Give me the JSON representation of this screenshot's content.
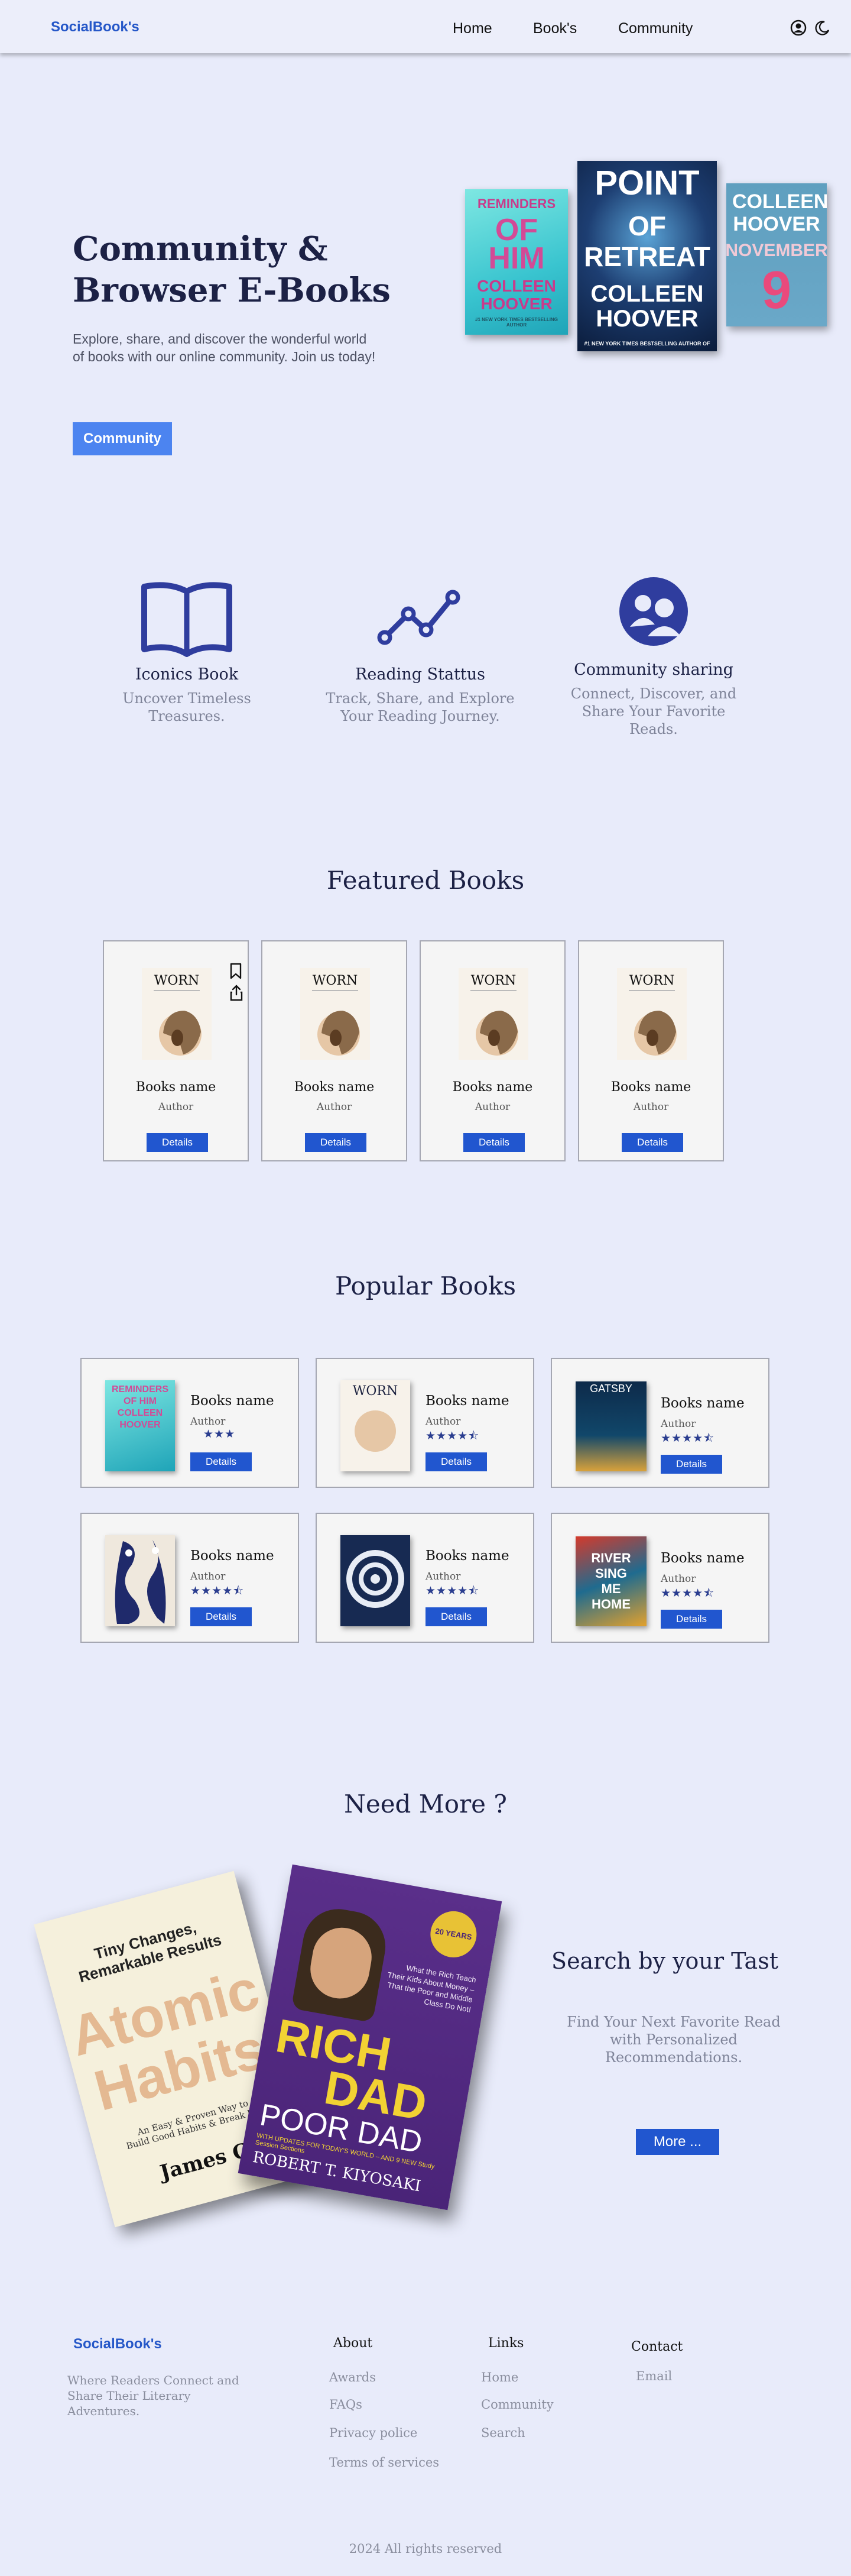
{
  "nav": {
    "logo": "SocialBook's",
    "links": [
      "Home",
      "Book's",
      "Community"
    ],
    "icons": [
      "user-circle-icon",
      "moon-icon"
    ]
  },
  "hero": {
    "title": "Community & Browser E-Books",
    "description": "Explore, share, and discover the wonderful world of books with our online community. Join us today!",
    "button": "Community",
    "covers": [
      {
        "top": "REMINDERS",
        "middle": "OF HIM",
        "author": "COLLEEN HOOVER",
        "bottom": "#1 NEW YORK TIMES BESTSELLING AUTHOR"
      },
      {
        "top": "POINT",
        "middle": "OF RETREAT",
        "author": "COLLEEN HOOVER",
        "bottom": "#1 NEW YORK TIMES BESTSELLING AUTHOR OF"
      },
      {
        "top": "COLLEEN HOOVER",
        "middle": "NOVEMBER",
        "author": "9",
        "bottom": ""
      }
    ]
  },
  "features": [
    {
      "icon": "open-book-icon",
      "title": "Iconics Book",
      "desc": "Uncover Timeless Treasures."
    },
    {
      "icon": "line-chart-icon",
      "title": "Reading Stattus",
      "desc": "Track, Share, and Explore Your Reading Journey."
    },
    {
      "icon": "community-icon",
      "title": "Community sharing",
      "desc": "Connect, Discover, and Share Your Favorite Reads."
    }
  ],
  "featured": {
    "title": "Featured Books",
    "cover_title": "WORN",
    "cards": [
      {
        "name": "Books name",
        "author": "Author",
        "button": "Details"
      },
      {
        "name": "Books name",
        "author": "Author",
        "button": "Details"
      },
      {
        "name": "Books name",
        "author": "Author",
        "button": "Details"
      },
      {
        "name": "Books name",
        "author": "Author",
        "button": "Details"
      }
    ]
  },
  "popular": {
    "title": "Popular Books",
    "cards": [
      {
        "name": "Books name",
        "author": "Author",
        "stars": "★★★",
        "rating": 3,
        "button": "Details",
        "cover_text": "REMINDERS OF HIM COLLEEN HOOVER"
      },
      {
        "name": "Books name",
        "author": "Author",
        "stars": "★★★★⯪",
        "rating": 4.5,
        "button": "Details",
        "cover_text": "WORN"
      },
      {
        "name": "Books name",
        "author": "Author",
        "stars": "★★★★⯪",
        "rating": 4.5,
        "button": "Details",
        "cover_text": "GATSBY"
      },
      {
        "name": "Books name",
        "author": "Author",
        "stars": "★★★★⯪",
        "rating": 4.5,
        "button": "Details",
        "cover_text": ""
      },
      {
        "name": "Books name",
        "author": "Author",
        "stars": "★★★★⯪",
        "rating": 4.5,
        "button": "Details",
        "cover_text": ""
      },
      {
        "name": "Books name",
        "author": "Author",
        "stars": "★★★★⯪",
        "rating": 4.5,
        "button": "Details",
        "cover_text": "RIVER SING ME HOME"
      }
    ]
  },
  "more": {
    "title": "Need More ?",
    "heading": "Search by your Tast",
    "desc": "Find Your Next Favorite Read with Personalized Recommendations.",
    "button": "More ...",
    "book1": {
      "line1": "Tiny Changes,",
      "line2": "Remarkable Results",
      "title1": "Atomic",
      "title2": "Habits",
      "sub1": "An Easy & Proven Way to",
      "sub2": "Build Good Habits & Break Bad",
      "author": "James C"
    },
    "book2": {
      "badge": "20 YEARS",
      "blurb": "What the Rich Teach Their Kids About Money – That the Poor and Middle Class Do Not!",
      "title1": "RICH",
      "title2": "DAD",
      "title3": "POOR DAD",
      "updates": "WITH UPDATES FOR TODAY'S WORLD – AND 9 NEW Study Session Sections",
      "author": "ROBERT T. KIYOSAKI"
    }
  },
  "footer": {
    "logo": "SocialBook's",
    "tagline": "Where Readers Connect and Share Their Literary Adventures.",
    "about": {
      "title": "About",
      "items": [
        "Awards",
        "FAQs",
        "Privacy police",
        "Terms of services"
      ]
    },
    "links": {
      "title": "Links",
      "items": [
        "Home",
        "Community",
        "Search"
      ]
    },
    "contact": {
      "title": "Contact",
      "items": [
        "Email"
      ]
    },
    "copyright": "2024 All rights reserved"
  }
}
